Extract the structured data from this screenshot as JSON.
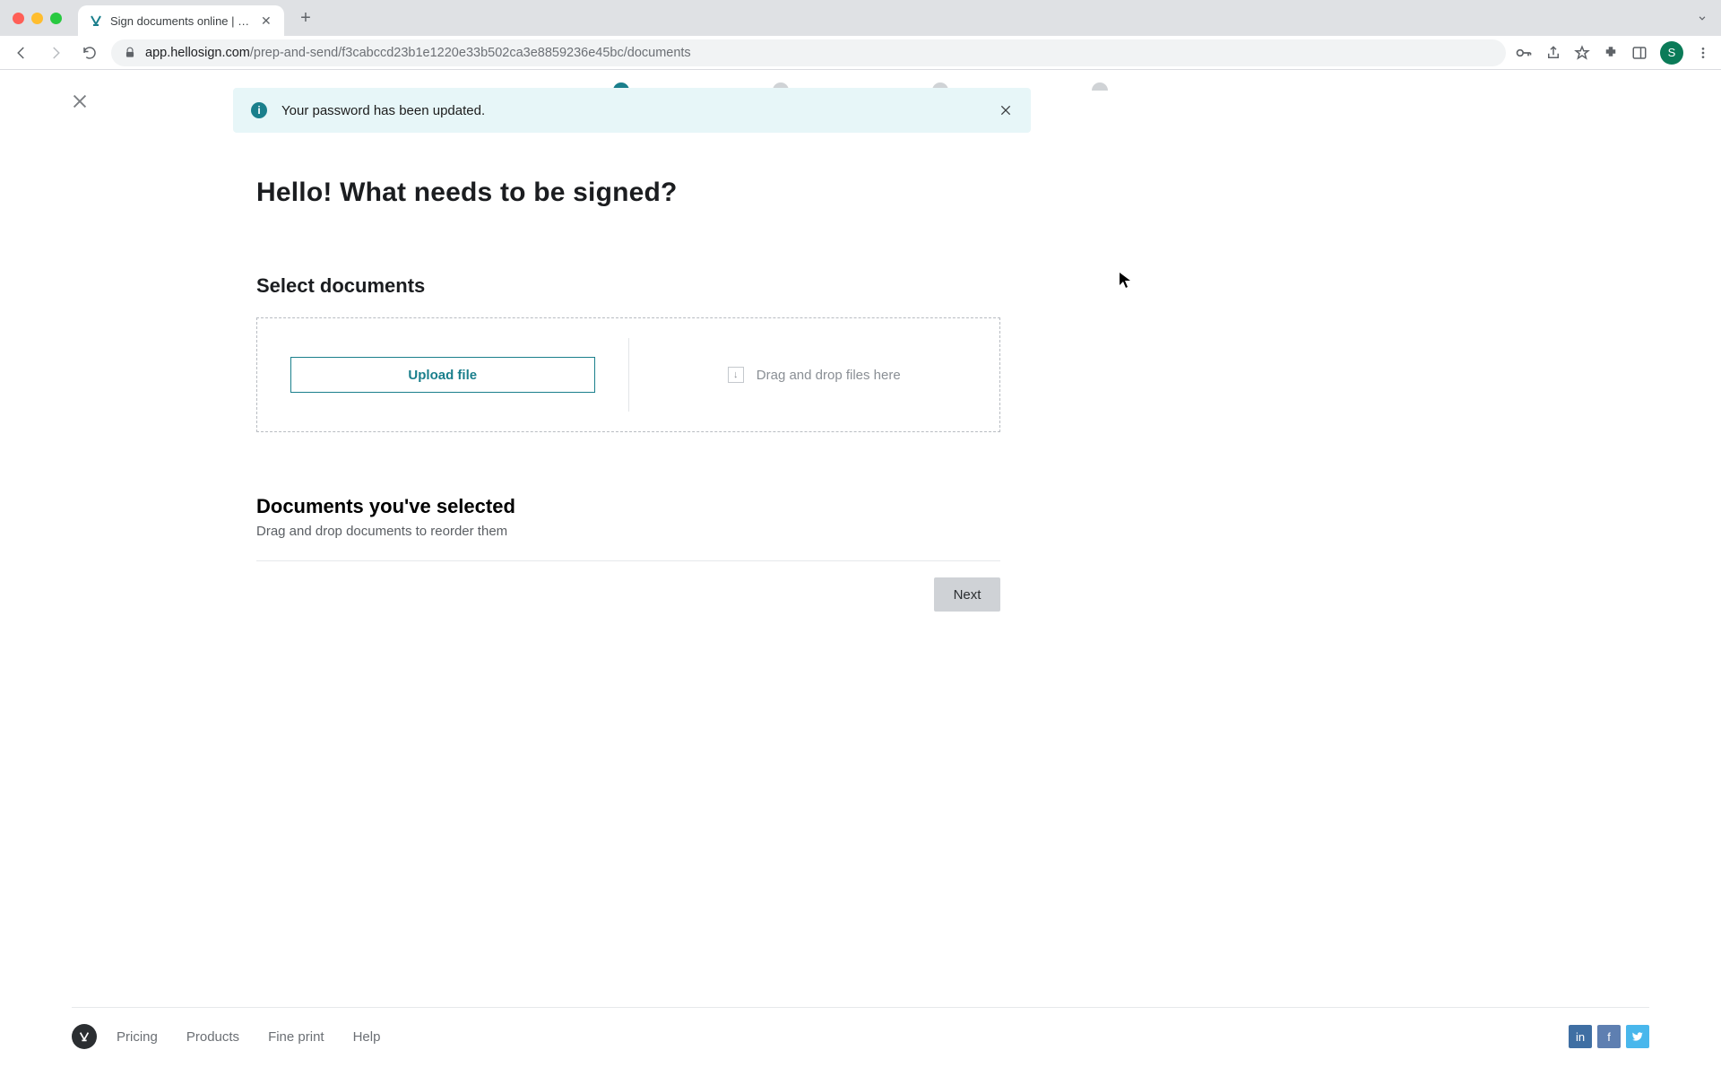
{
  "browser": {
    "tab_title": "Sign documents online | HelloS",
    "url_host": "app.hellosign.com",
    "url_path": "/prep-and-send/f3cabccd23b1e1220e33b502ca3e8859236e45bc/documents",
    "avatar_initial": "S"
  },
  "banner": {
    "message": "Your password has been updated."
  },
  "page": {
    "title": "Hello! What needs to be signed?",
    "select_title": "Select documents",
    "upload_label": "Upload file",
    "drop_label": "Drag and drop files here",
    "selected_title": "Documents you've selected",
    "selected_sub": "Drag and drop documents to reorder them",
    "next_label": "Next"
  },
  "footer": {
    "links": [
      "Pricing",
      "Products",
      "Fine print",
      "Help"
    ]
  }
}
